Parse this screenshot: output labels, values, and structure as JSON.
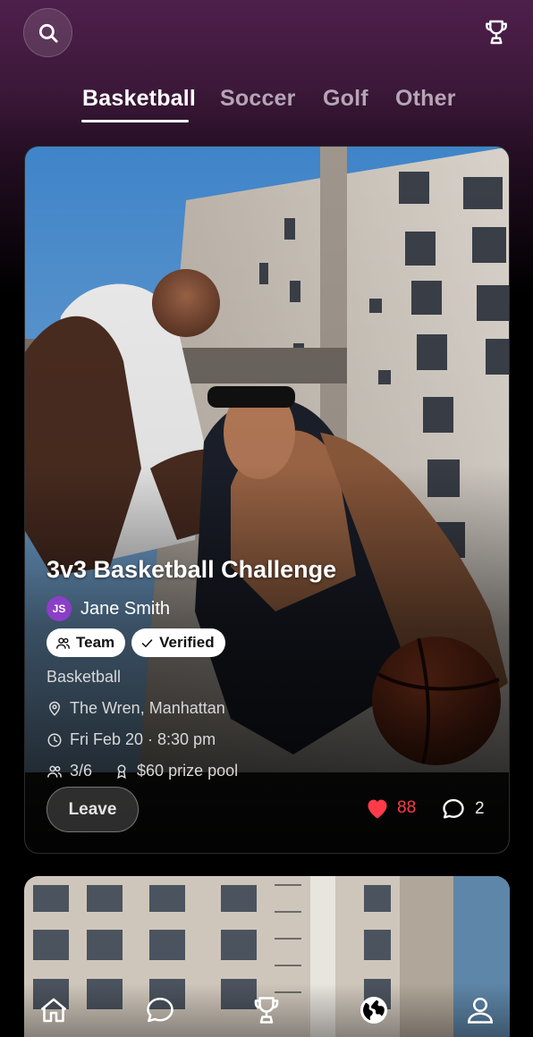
{
  "header": {
    "search_icon": "search-icon",
    "leaderboard_icon": "trophy-icon"
  },
  "tabs": [
    {
      "label": "Basketball",
      "active": true
    },
    {
      "label": "Soccer",
      "active": false
    },
    {
      "label": "Golf",
      "active": false
    },
    {
      "label": "Other",
      "active": false
    }
  ],
  "event": {
    "title": "3v3 Basketball Challenge",
    "host": {
      "initials": "JS",
      "name": "Jane Smith",
      "avatar_color": "#8b3fc7"
    },
    "chips": [
      {
        "label": "Team",
        "icon": "users-icon"
      },
      {
        "label": "Verified",
        "icon": "check-icon"
      }
    ],
    "sport": "Basketball",
    "location": "The Wren, Manhattan",
    "datetime": "Fri Feb 20 · 8:30 pm",
    "players": "3/6",
    "prize": "$60 prize pool",
    "action_label": "Leave",
    "likes": "88",
    "comments": "2",
    "like_color": "#ff3b4a"
  },
  "nav": [
    {
      "icon": "home-icon"
    },
    {
      "icon": "chat-icon"
    },
    {
      "icon": "trophy-icon"
    },
    {
      "icon": "globe-icon",
      "active": true
    },
    {
      "icon": "profile-icon"
    }
  ],
  "colors": {
    "header_top": "#4e1f4c",
    "background": "#000000",
    "accent": "#8b3fc7"
  }
}
